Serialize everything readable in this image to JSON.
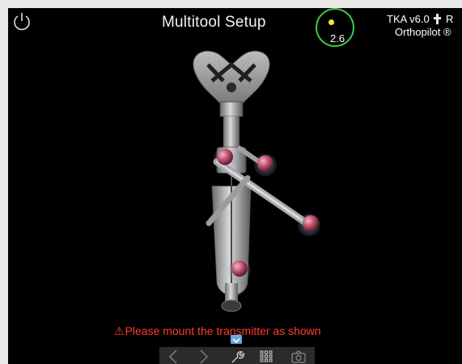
{
  "header": {
    "title": "Multitool Setup",
    "navigation_value": "2.6",
    "version": "TKA v6.0",
    "version_extra": "R",
    "product": "Orthopilot",
    "product_extra": "®"
  },
  "message": {
    "warning_symbol": "⚠",
    "text": "Please mount the transmitter as shown"
  },
  "toolbar": {
    "icons": [
      "chevron-left-icon",
      "chevron-right-icon",
      "wrench-icon",
      "grid-icon",
      "camera-icon"
    ]
  },
  "colors": {
    "accent_green": "#3fc245",
    "marker_yellow": "#f4ea2a",
    "warning_red": "#ff3c2a",
    "tab_blue": "#6fa6d8"
  }
}
